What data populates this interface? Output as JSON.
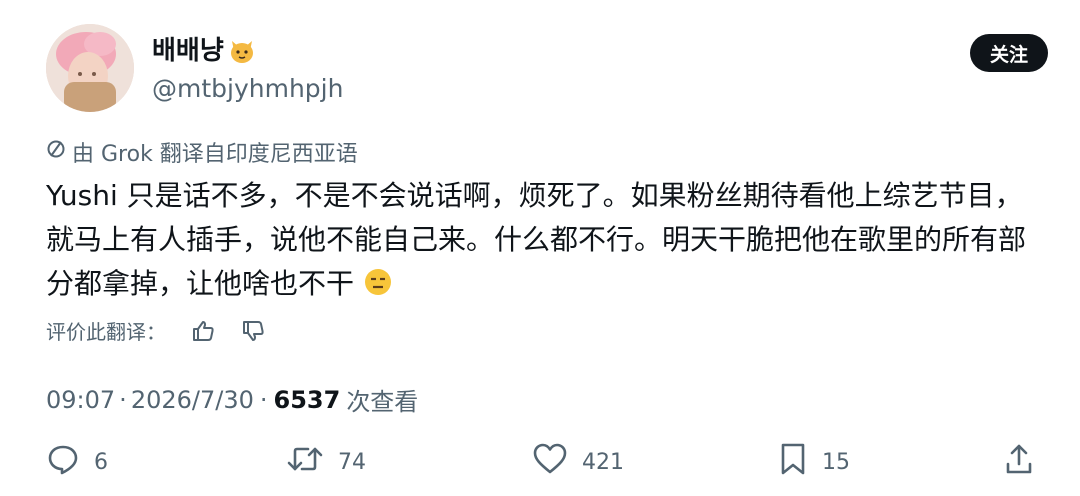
{
  "author": {
    "display_name": "배배냥",
    "handle": "@mtbjyhmhpjh",
    "name_emoji": "cat-face-emoji",
    "avatar": "profile-avatar"
  },
  "follow_label": "关注",
  "translation": {
    "by_label": "由 Grok 翻译自印度尼西亚语",
    "rate_label": "评价此翻译："
  },
  "tweet": {
    "text": "Yushi 只是话不多，不是不会说话啊，烦死了。如果粉丝期待看他上综艺节目，就马上有人插手，说他不能自己来。什么都不行。明天干脆把他在歌里的所有部分都拿掉，让他啥也不干",
    "emoji": "expressionless-face-emoji"
  },
  "meta": {
    "time": "09:07",
    "sep1": "·",
    "date": "2026/7/30",
    "sep2": "·",
    "views_count": "6537",
    "views_label": "次查看"
  },
  "actions": {
    "replies": "6",
    "reposts": "74",
    "likes": "421",
    "bookmarks": "15"
  },
  "colors": {
    "text": "#0f1419",
    "secondary": "#536471",
    "button_bg": "#0f1419"
  }
}
